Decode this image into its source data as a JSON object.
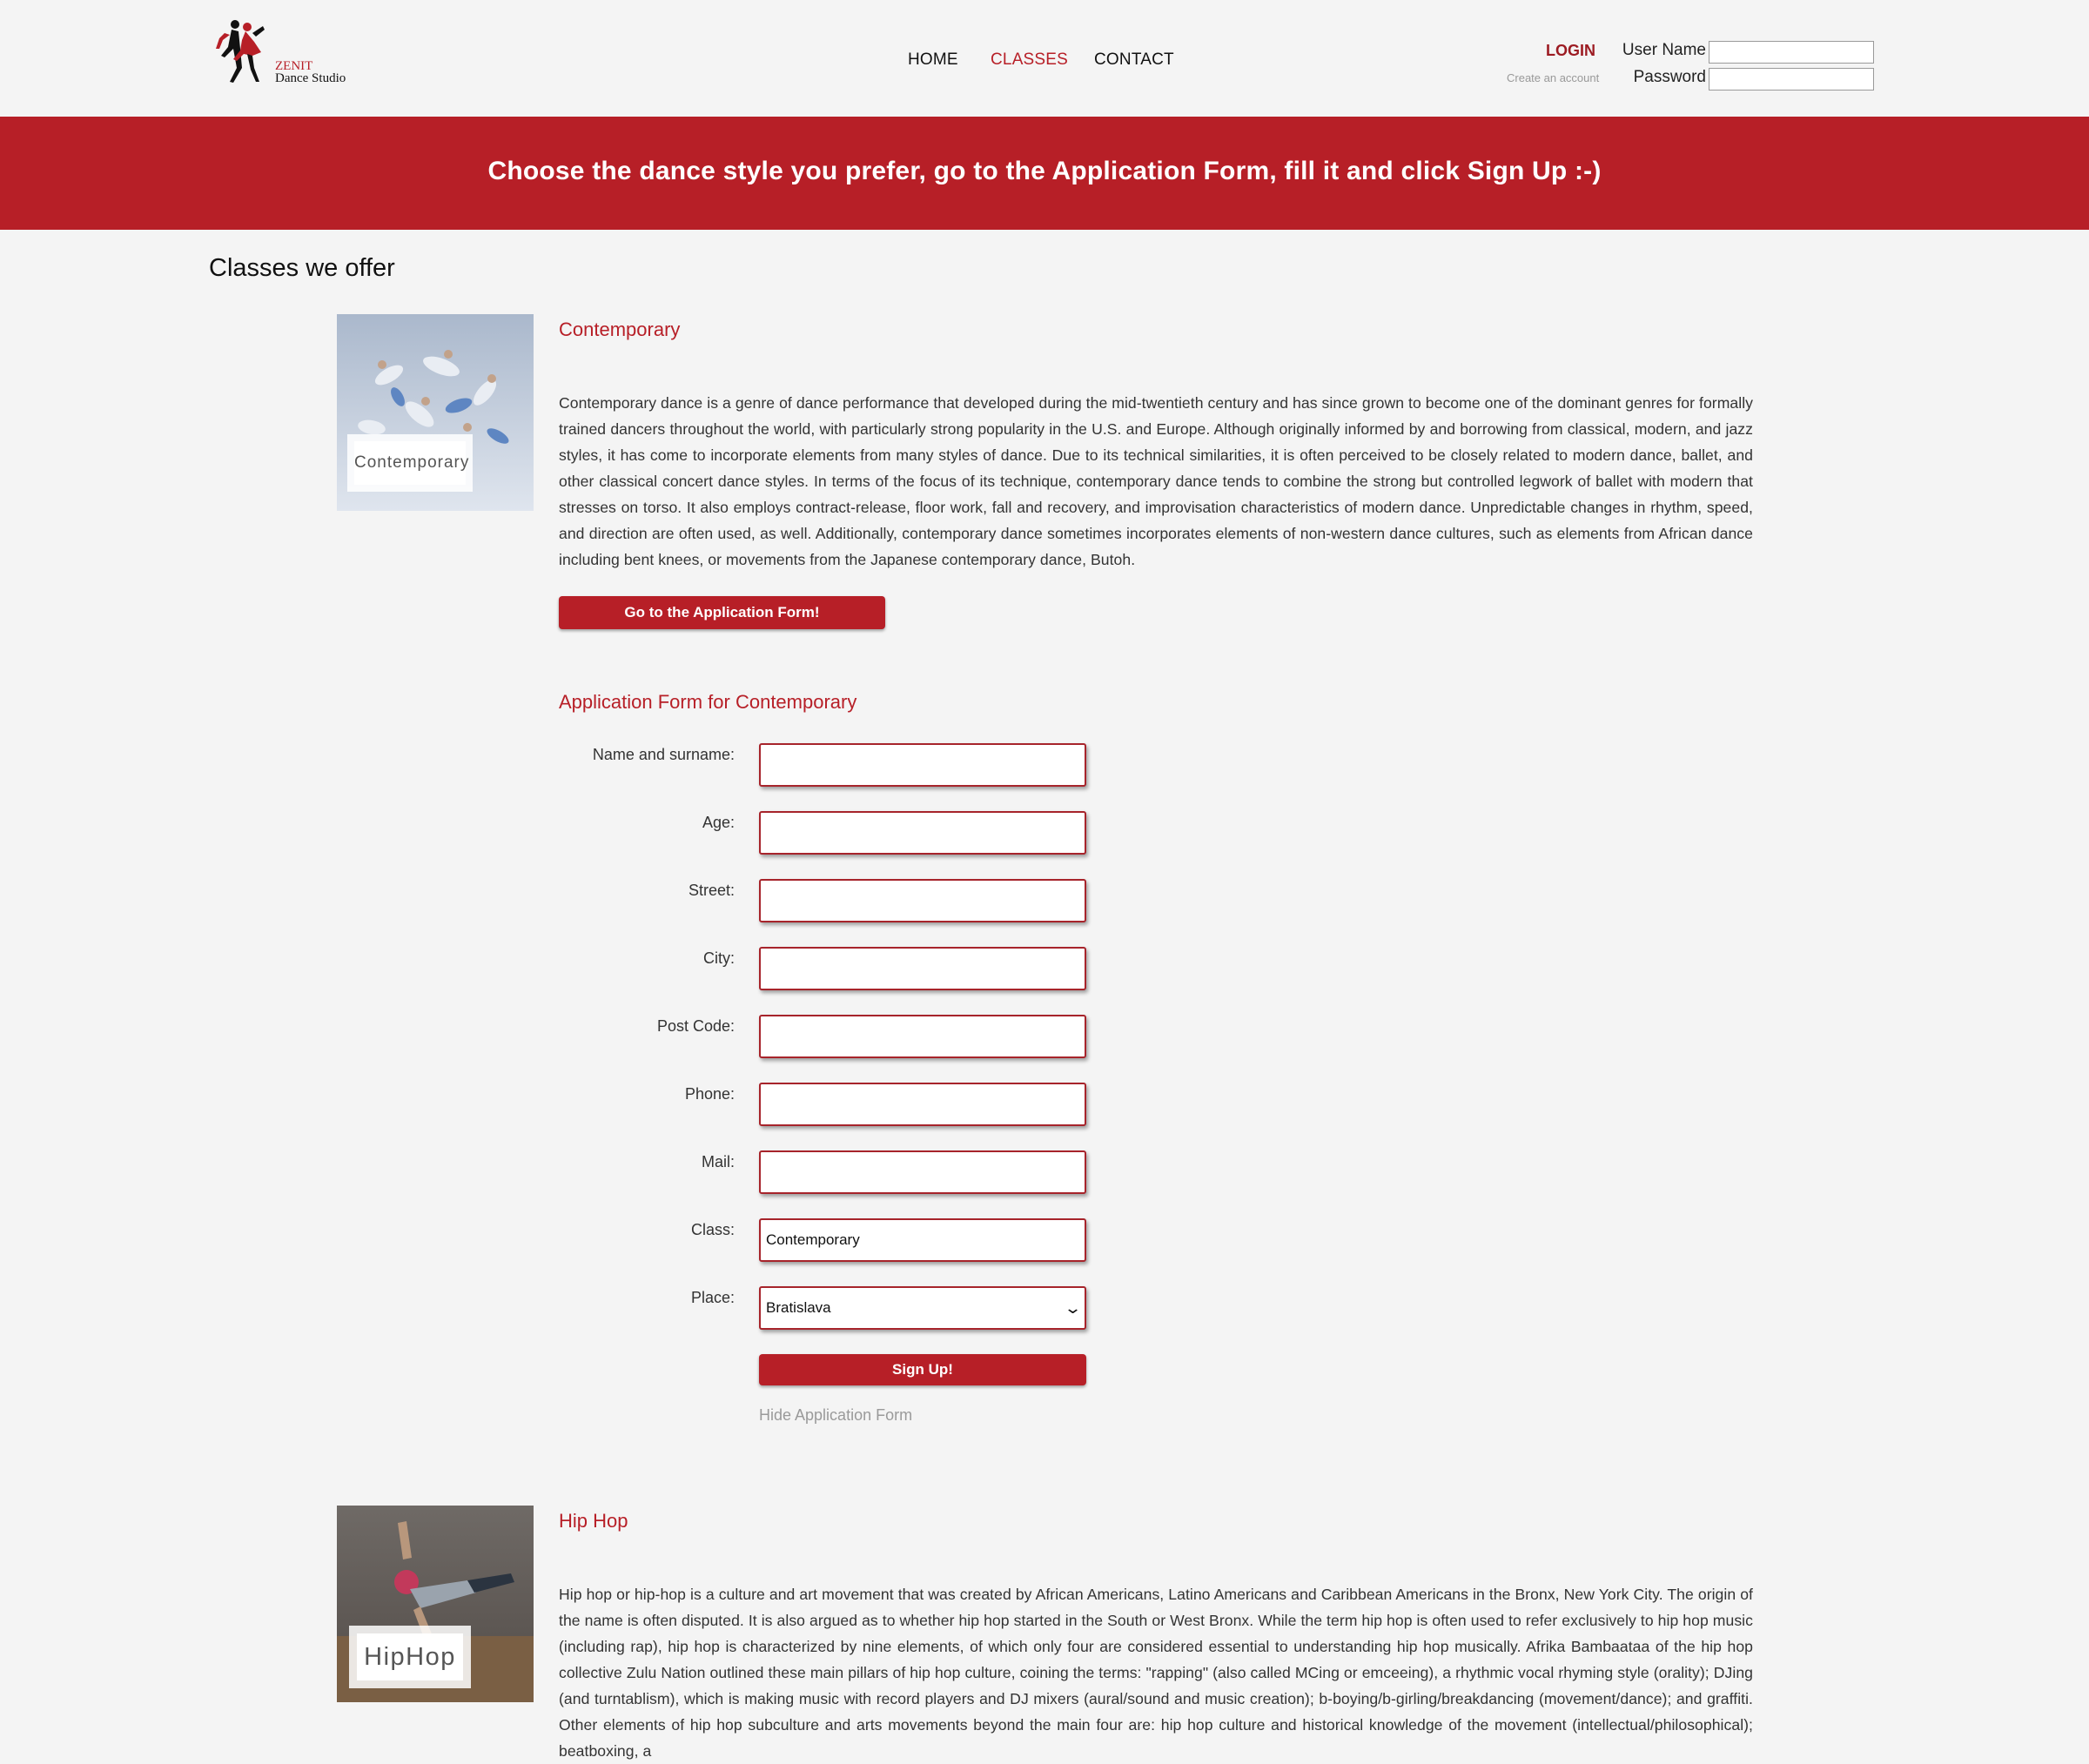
{
  "header": {
    "logo": {
      "line1": "ZENIT",
      "line2": "Dance Studio"
    },
    "nav": [
      {
        "label": "HOME",
        "active": false
      },
      {
        "label": "CLASSES",
        "active": true
      },
      {
        "label": "CONTACT",
        "active": false
      }
    ],
    "login": {
      "title": "LOGIN",
      "create_account": "Create an account",
      "username_label": "User Name",
      "password_label": "Password"
    }
  },
  "banner": {
    "text": "Choose the dance style you prefer, go to the Application Form, fill it and click Sign Up :-)"
  },
  "section_title": "Classes we offer",
  "classes": [
    {
      "image_label": "Contemporary",
      "title": "Contemporary",
      "description": "Contemporary dance is a genre of dance performance that developed during the mid-twentieth century and has since grown to become one of the dominant genres for formally trained dancers throughout the world, with particularly strong popularity in the U.S. and Europe. Although originally informed by and borrowing from classical, modern, and jazz styles, it has come to incorporate elements from many styles of dance. Due to its technical similarities, it is often perceived to be closely related to modern dance, ballet, and other classical concert dance styles. In terms of the focus of its technique, contemporary dance tends to combine the strong but controlled legwork of ballet with modern that stresses on torso. It also employs contract-release, floor work, fall and recovery, and improvisation characteristics of modern dance. Unpredictable changes in rhythm, speed, and direction are often used, as well. Additionally, contemporary dance sometimes incorporates elements of non-western dance cultures, such as elements from African dance including bent knees, or movements from the Japanese contemporary dance, Butoh.",
      "button_label": "Go to the Application Form!"
    },
    {
      "image_label": "HipHop",
      "title": "Hip Hop",
      "description": "Hip hop or hip-hop is a culture and art movement that was created by African Americans, Latino Americans and Caribbean Americans in the Bronx, New York City. The origin of the name is often disputed. It is also argued as to whether hip hop started in the South or West Bronx. While the term hip hop is often used to refer exclusively to hip hop music (including rap), hip hop is characterized by nine elements, of which only four are considered essential to understanding hip hop musically. Afrika Bambaataa of the hip hop collective Zulu Nation outlined these main pillars of hip hop culture, coining the terms: \"rapping\" (also called MCing or emceeing), a rhythmic vocal rhyming style (orality); DJing (and turntablism), which is making music with record players and DJ mixers (aural/sound and music creation); b-boying/b-girling/breakdancing (movement/dance); and graffiti. Other elements of hip hop subculture and arts movements beyond the main four are: hip hop culture and historical knowledge of the movement (intellectual/philosophical); beatboxing, a"
    }
  ],
  "form": {
    "title": "Application Form for Contemporary",
    "fields": [
      {
        "label": "Name and surname:",
        "value": ""
      },
      {
        "label": "Age:",
        "value": ""
      },
      {
        "label": "Street:",
        "value": ""
      },
      {
        "label": "City:",
        "value": ""
      },
      {
        "label": "Post Code:",
        "value": ""
      },
      {
        "label": "Phone:",
        "value": ""
      },
      {
        "label": "Mail:",
        "value": ""
      },
      {
        "label": "Class:",
        "value": "Contemporary"
      }
    ],
    "place": {
      "label": "Place:",
      "selected": "Bratislava"
    },
    "submit_label": "Sign Up!",
    "hide_label": "Hide Application Form"
  },
  "colors": {
    "accent": "#b71f27",
    "background": "#f4f4f4"
  }
}
